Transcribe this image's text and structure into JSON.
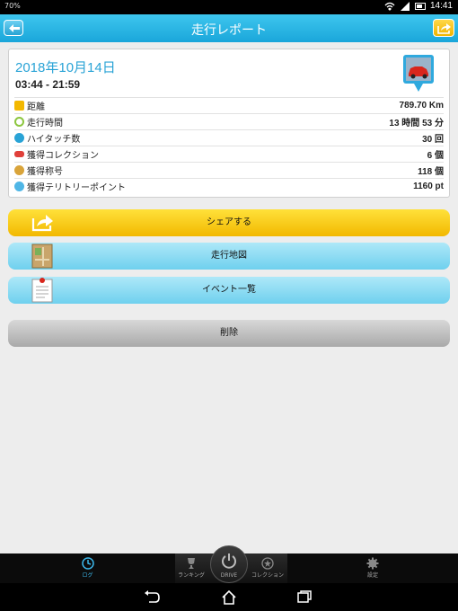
{
  "status_bar": {
    "time": "14:41",
    "left_icon_text": "70%"
  },
  "header": {
    "title": "走行レポート"
  },
  "report": {
    "date": "2018年10月14日",
    "time_range": "03:44 - 21:59",
    "stats": [
      {
        "label": "距離",
        "value": "789.70 Km",
        "icon": "distance-icon",
        "color": "#f3b800"
      },
      {
        "label": "走行時間",
        "value": "13 時間 53 分",
        "icon": "clock-icon",
        "color": "#8cc63f"
      },
      {
        "label": "ハイタッチ数",
        "value": "30 回",
        "icon": "hand-icon",
        "color": "#29a3d6"
      },
      {
        "label": "獲得コレクション",
        "value": "6 個",
        "icon": "car-icon",
        "color": "#e0403a"
      },
      {
        "label": "獲得称号",
        "value": "118 個",
        "icon": "medal-icon",
        "color": "#d9a43a"
      },
      {
        "label": "獲得テリトリーポイント",
        "value": "1160 pt",
        "icon": "territory-icon",
        "color": "#4fb6e6"
      }
    ]
  },
  "actions": {
    "share": "シェアする",
    "map": "走行地図",
    "events": "イベント一覧",
    "delete": "削除"
  },
  "tabs": {
    "log": "ログ",
    "ranking": "ランキング",
    "drive": "DRIVE",
    "collection": "コレクション",
    "settings": "設定"
  }
}
